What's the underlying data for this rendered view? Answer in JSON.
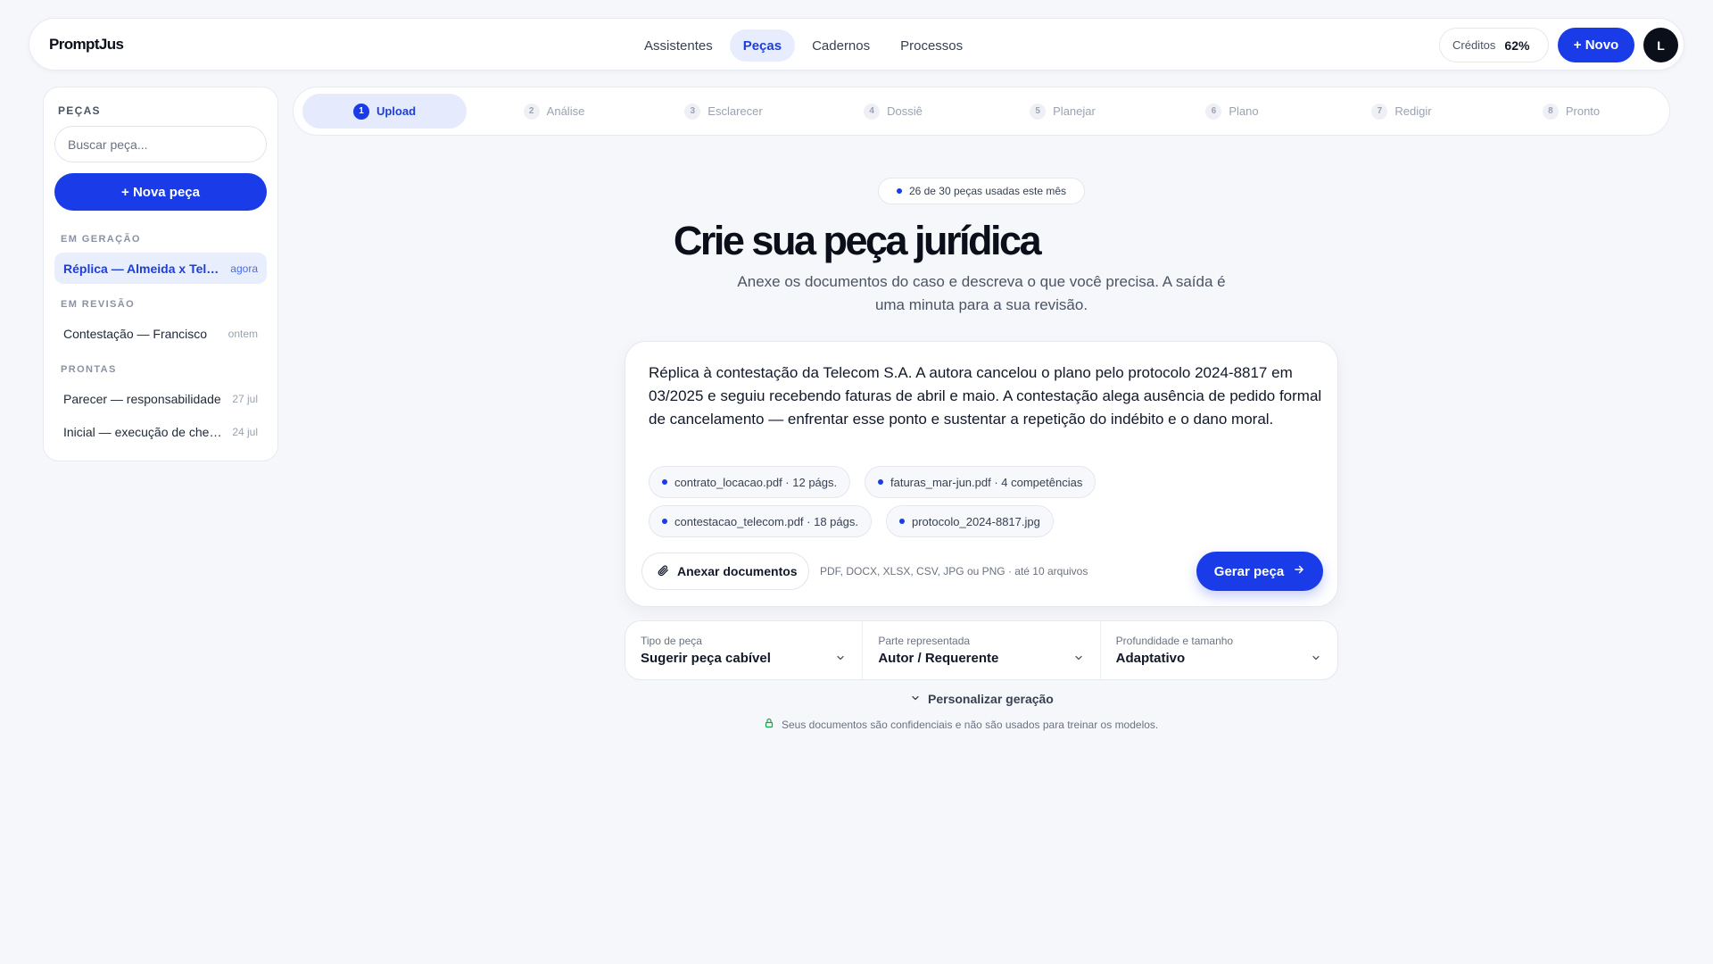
{
  "app": {
    "brand": "PromptJus"
  },
  "nav": {
    "items": [
      {
        "label": "Assistentes",
        "active": false
      },
      {
        "label": "Peças",
        "active": true
      },
      {
        "label": "Cadernos",
        "active": false
      },
      {
        "label": "Processos",
        "active": false
      }
    ]
  },
  "header": {
    "credits_label": "Créditos",
    "credits_value": "62%",
    "new_button": "+ Novo",
    "avatar_initial": "L"
  },
  "sidebar": {
    "title": "PEÇAS",
    "search_placeholder": "Buscar peça...",
    "new_button": "+ Nova peça",
    "groups": [
      {
        "label": "EM GERAÇÃO",
        "items": [
          {
            "name": "Réplica — Almeida x Telecom S.A.",
            "when": "agora",
            "active": true
          }
        ]
      },
      {
        "label": "EM REVISÃO",
        "items": [
          {
            "name": "Contestação — Francisco",
            "when": "ontem",
            "active": false
          }
        ]
      },
      {
        "label": "PRONTAS",
        "items": [
          {
            "name": "Parecer — responsabilidade",
            "when": "27 jul",
            "active": false
          },
          {
            "name": "Inicial — execução de cheque",
            "when": "24 jul",
            "active": false
          }
        ]
      }
    ]
  },
  "stepper": {
    "steps": [
      {
        "num": "1",
        "label": "Upload",
        "active": true
      },
      {
        "num": "2",
        "label": "Análise",
        "active": false
      },
      {
        "num": "3",
        "label": "Esclarecer",
        "active": false
      },
      {
        "num": "4",
        "label": "Dossiê",
        "active": false
      },
      {
        "num": "5",
        "label": "Planejar",
        "active": false
      },
      {
        "num": "6",
        "label": "Plano",
        "active": false
      },
      {
        "num": "7",
        "label": "Redigir",
        "active": false
      },
      {
        "num": "8",
        "label": "Pronto",
        "active": false
      }
    ]
  },
  "main": {
    "usage_badge": "26 de 30 peças usadas este mês",
    "title": "Crie sua peça jurídica",
    "subtitle": "Anexe os documentos do caso e descreva o que você precisa. A saída é uma minuta para a sua revisão.",
    "prompt_text": "Réplica à contestação da Telecom S.A. A autora cancelou o plano pelo protocolo 2024-8817 em 03/2025 e seguiu recebendo faturas de abril e maio. A contestação alega ausência de pedido formal de cancelamento — enfrentar esse ponto e sustentar a repetição do indébito e o dano moral.",
    "attachments": [
      "contrato_locacao.pdf · 12 págs.",
      "faturas_mar-jun.pdf · 4 competências",
      "contestacao_telecom.pdf · 18 págs.",
      "protocolo_2024-8817.jpg"
    ],
    "attach_button": "Anexar documentos",
    "formats_hint": "PDF, DOCX, XLSX, CSV, JPG ou PNG · até 10 arquivos",
    "generate_button": "Gerar peça",
    "selects": [
      {
        "label": "Tipo de peça",
        "value": "Sugerir peça cabível"
      },
      {
        "label": "Parte representada",
        "value": "Autor / Requerente"
      },
      {
        "label": "Profundidade e tamanho",
        "value": "Adaptativo"
      }
    ],
    "personalize": "Personalizar geração",
    "privacy_note": "Seus documentos são confidenciais e não são usados para treinar os modelos."
  },
  "colors": {
    "accent": "#1a3ce8",
    "accent_soft": "#e8edfd",
    "background": "#f6f7fb",
    "privacy_icon": "#16a34a"
  },
  "icons": {
    "attach": "paperclip-icon",
    "generate": "arrow-right-icon",
    "select": "chevron-down-icon",
    "privacy": "lock-icon"
  }
}
